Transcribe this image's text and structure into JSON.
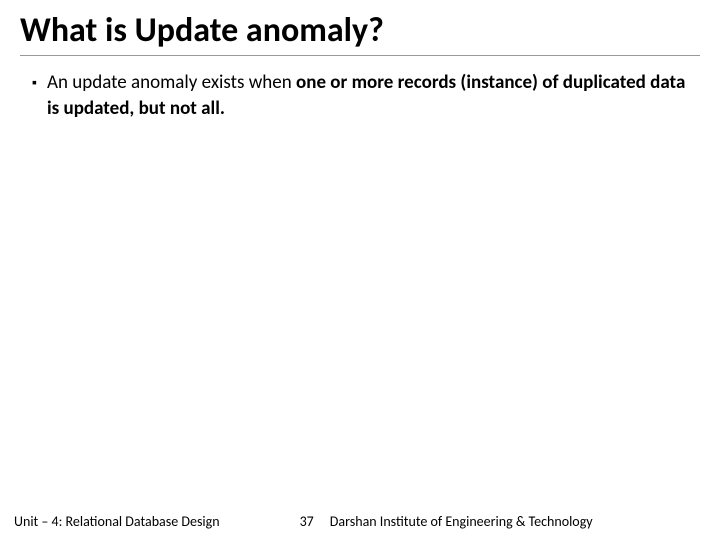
{
  "title": "What is Update anomaly?",
  "bullet": {
    "prefix": "An update anomaly exists when ",
    "bold_part": "one or more records (instance) of duplicated data is updated, but not all."
  },
  "footer": {
    "unit": "Unit – 4: Relational Database Design",
    "page": "37",
    "institute": "Darshan Institute of Engineering & Technology"
  }
}
